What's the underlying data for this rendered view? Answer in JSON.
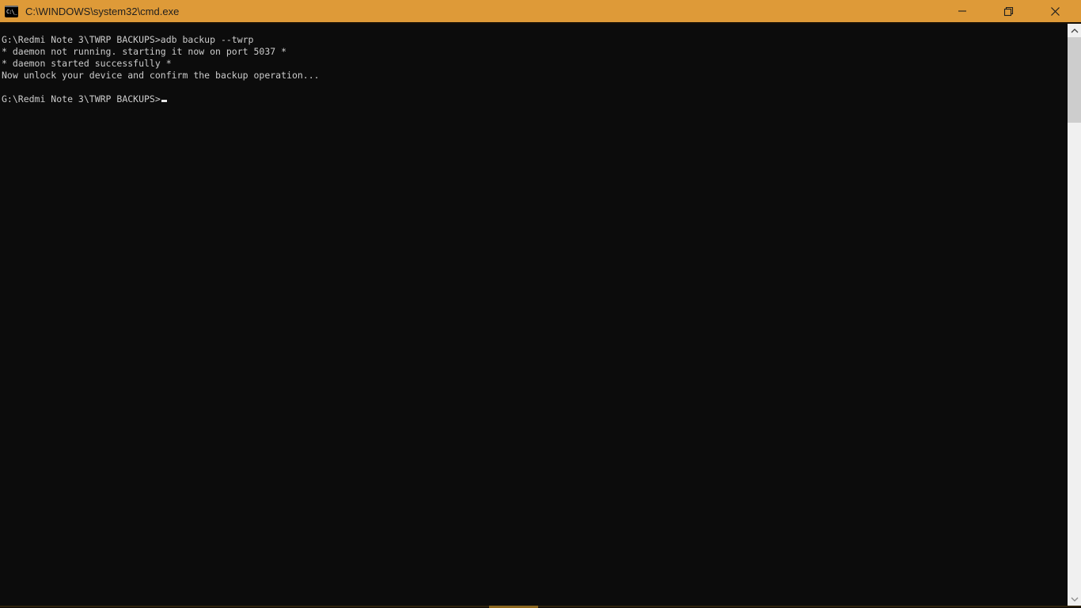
{
  "window": {
    "title": "C:\\WINDOWS\\system32\\cmd.exe"
  },
  "titlebar": {
    "icon_text": "C:\\_",
    "background_color": "#de9a38",
    "text_color": "#1e1e1e",
    "controls": [
      "minimize",
      "restore",
      "close"
    ]
  },
  "console": {
    "background_color": "#0c0c0c",
    "text_color": "#cccccc",
    "lines": [
      "G:\\Redmi Note 3\\TWRP BACKUPS>adb backup --twrp",
      "* daemon not running. starting it now on port 5037 *",
      "* daemon started successfully *",
      "Now unlock your device and confirm the backup operation...",
      "",
      "G:\\Redmi Note 3\\TWRP BACKUPS>"
    ],
    "cursor_visible": true
  },
  "scrollbar": {
    "track_color": "#f0f0f0",
    "thumb_color": "#cdcdcd"
  },
  "taskbar_peek_color": "#8a651d"
}
